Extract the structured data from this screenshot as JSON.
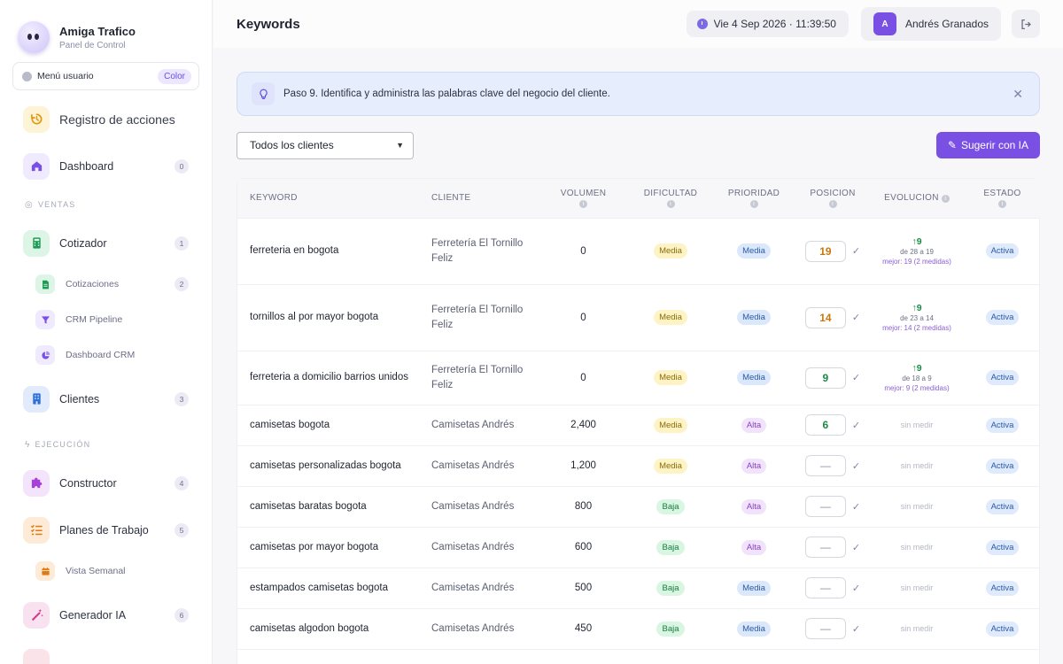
{
  "brand": {
    "title": "Amiga Trafico",
    "subtitle": "Panel de Control"
  },
  "user_menu": {
    "label": "Menú usuario",
    "color_chip": "Color"
  },
  "sidebar": {
    "registro": "Registro de acciones",
    "dashboard": {
      "label": "Dashboard",
      "count": "0"
    },
    "section_ventas": "VENTAS",
    "cotizador": {
      "label": "Cotizador",
      "count": "1"
    },
    "cotizaciones": {
      "label": "Cotizaciones",
      "count": "2"
    },
    "crm_pipeline": "CRM Pipeline",
    "dashboard_crm": "Dashboard CRM",
    "clientes": {
      "label": "Clientes",
      "count": "3"
    },
    "section_ejecucion": "EJECUCIÓN",
    "constructor": {
      "label": "Constructor",
      "count": "4"
    },
    "planes": {
      "label": "Planes de Trabajo",
      "count": "5"
    },
    "vista_semanal": "Vista Semanal",
    "generador": {
      "label": "Generador IA",
      "count": "6"
    }
  },
  "header": {
    "title": "Keywords",
    "datetime": "Vie 4 Sep 2026 · 11:39:50",
    "user_initial": "A",
    "user_name": "Andrés Granados"
  },
  "banner": {
    "message": "Paso 9. Identifica y administra las palabras clave del negocio del cliente."
  },
  "toolbar": {
    "client_filter": "Todos los clientes",
    "suggest_label": "Sugerir con IA"
  },
  "table": {
    "headers": {
      "keyword": "KEYWORD",
      "cliente": "CLIENTE",
      "volumen": "VOLUMEN",
      "dificultad": "DIFICULTAD",
      "prioridad": "PRIORIDAD",
      "posicion": "POSICION",
      "evolucion": "EVOLUCION",
      "estado": "ESTADO"
    },
    "rows": [
      {
        "keyword": "ferreteria en bogota",
        "cliente": "Ferretería El Tornillo Feliz",
        "volumen": "0",
        "dificultad": "Media",
        "prioridad": "Media",
        "posicion": "19",
        "evo_up": "↑9",
        "evo_from": "de 28 a 19",
        "evo_best": "mejor: 19 (2 medidas)",
        "estado": "Activa"
      },
      {
        "keyword": "tornillos al por mayor bogota",
        "cliente": "Ferretería El Tornillo Feliz",
        "volumen": "0",
        "dificultad": "Media",
        "prioridad": "Media",
        "posicion": "14",
        "evo_up": "↑9",
        "evo_from": "de 23 a 14",
        "evo_best": "mejor: 14 (2 medidas)",
        "estado": "Activa"
      },
      {
        "keyword": "ferreteria a domicilio barrios unidos",
        "cliente": "Ferretería El Tornillo Feliz",
        "volumen": "0",
        "dificultad": "Media",
        "prioridad": "Media",
        "posicion": "9",
        "evo_up": "↑9",
        "evo_from": "de 18 a 9",
        "evo_best": "mejor: 9 (2 medidas)",
        "estado": "Activa"
      },
      {
        "keyword": "camisetas bogota",
        "cliente": "Camisetas Andrés",
        "volumen": "2,400",
        "dificultad": "Media",
        "prioridad": "Alta",
        "posicion": "6",
        "evo_none": "sin medir",
        "estado": "Activa"
      },
      {
        "keyword": "camisetas personalizadas bogota",
        "cliente": "Camisetas Andrés",
        "volumen": "1,200",
        "dificultad": "Media",
        "prioridad": "Alta",
        "posicion": "—",
        "evo_none": "sin medir",
        "estado": "Activa"
      },
      {
        "keyword": "camisetas baratas bogota",
        "cliente": "Camisetas Andrés",
        "volumen": "800",
        "dificultad": "Baja",
        "prioridad": "Alta",
        "posicion": "—",
        "evo_none": "sin medir",
        "estado": "Activa"
      },
      {
        "keyword": "camisetas por mayor bogota",
        "cliente": "Camisetas Andrés",
        "volumen": "600",
        "dificultad": "Baja",
        "prioridad": "Alta",
        "posicion": "—",
        "evo_none": "sin medir",
        "estado": "Activa"
      },
      {
        "keyword": "estampados camisetas bogota",
        "cliente": "Camisetas Andrés",
        "volumen": "500",
        "dificultad": "Baja",
        "prioridad": "Media",
        "posicion": "—",
        "evo_none": "sin medir",
        "estado": "Activa"
      },
      {
        "keyword": "camisetas algodon bogota",
        "cliente": "Camisetas Andrés",
        "volumen": "450",
        "dificultad": "Baja",
        "prioridad": "Media",
        "posicion": "—",
        "evo_none": "sin medir",
        "estado": "Activa"
      }
    ]
  },
  "colors": {
    "accent": "#7a4fe4",
    "banner_bg": "#e6edfc"
  }
}
